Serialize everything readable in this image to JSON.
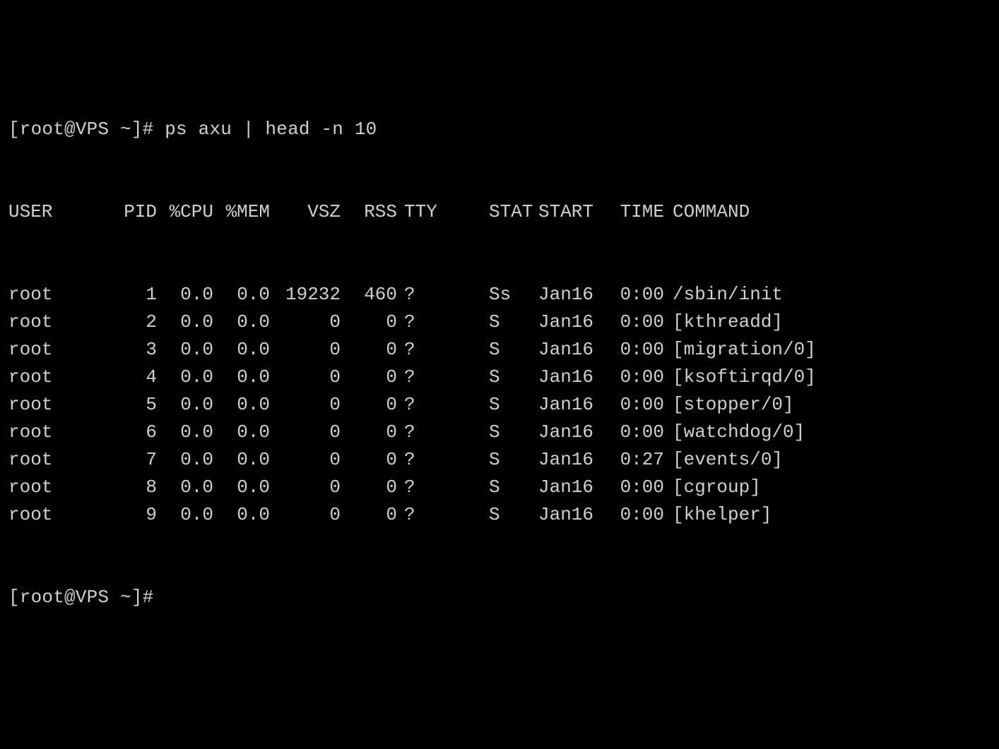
{
  "prompt1": "[root@VPS ~]# ps axu | head -n 10",
  "prompt2": "[root@VPS ~]#",
  "headers": {
    "user": "USER",
    "pid": "PID",
    "cpu": "%CPU",
    "mem": "%MEM",
    "vsz": "VSZ",
    "rss": "RSS",
    "tty": "TTY",
    "stat": "STAT",
    "start": "START",
    "time": "TIME",
    "command": "COMMAND"
  },
  "rows": [
    {
      "user": "root",
      "pid": "1",
      "cpu": "0.0",
      "mem": "0.0",
      "vsz": "19232",
      "rss": "460",
      "tty": "?",
      "stat": "Ss",
      "start": "Jan16",
      "time": "0:00",
      "command": "/sbin/init"
    },
    {
      "user": "root",
      "pid": "2",
      "cpu": "0.0",
      "mem": "0.0",
      "vsz": "0",
      "rss": "0",
      "tty": "?",
      "stat": "S",
      "start": "Jan16",
      "time": "0:00",
      "command": "[kthreadd]"
    },
    {
      "user": "root",
      "pid": "3",
      "cpu": "0.0",
      "mem": "0.0",
      "vsz": "0",
      "rss": "0",
      "tty": "?",
      "stat": "S",
      "start": "Jan16",
      "time": "0:00",
      "command": "[migration/0]"
    },
    {
      "user": "root",
      "pid": "4",
      "cpu": "0.0",
      "mem": "0.0",
      "vsz": "0",
      "rss": "0",
      "tty": "?",
      "stat": "S",
      "start": "Jan16",
      "time": "0:00",
      "command": "[ksoftirqd/0]"
    },
    {
      "user": "root",
      "pid": "5",
      "cpu": "0.0",
      "mem": "0.0",
      "vsz": "0",
      "rss": "0",
      "tty": "?",
      "stat": "S",
      "start": "Jan16",
      "time": "0:00",
      "command": "[stopper/0]"
    },
    {
      "user": "root",
      "pid": "6",
      "cpu": "0.0",
      "mem": "0.0",
      "vsz": "0",
      "rss": "0",
      "tty": "?",
      "stat": "S",
      "start": "Jan16",
      "time": "0:00",
      "command": "[watchdog/0]"
    },
    {
      "user": "root",
      "pid": "7",
      "cpu": "0.0",
      "mem": "0.0",
      "vsz": "0",
      "rss": "0",
      "tty": "?",
      "stat": "S",
      "start": "Jan16",
      "time": "0:27",
      "command": "[events/0]"
    },
    {
      "user": "root",
      "pid": "8",
      "cpu": "0.0",
      "mem": "0.0",
      "vsz": "0",
      "rss": "0",
      "tty": "?",
      "stat": "S",
      "start": "Jan16",
      "time": "0:00",
      "command": "[cgroup]"
    },
    {
      "user": "root",
      "pid": "9",
      "cpu": "0.0",
      "mem": "0.0",
      "vsz": "0",
      "rss": "0",
      "tty": "?",
      "stat": "S",
      "start": "Jan16",
      "time": "0:00",
      "command": "[khelper]"
    }
  ]
}
